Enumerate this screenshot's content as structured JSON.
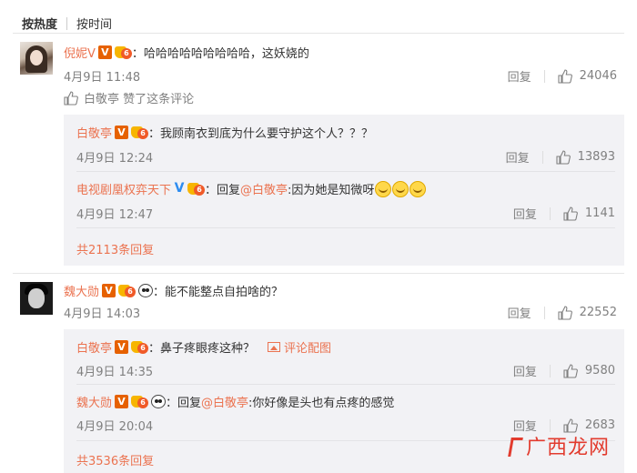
{
  "sort": {
    "hot": "按热度",
    "time": "按时间"
  },
  "labels": {
    "reply": "回复"
  },
  "comments": [
    {
      "user": "倪妮V",
      "text": "：哈哈哈哈哈哈哈哈哈，这妖娆的",
      "time": "4月9日 11:48",
      "likes": "24046",
      "liked_by": "白敬亭 赞了这条评论",
      "replies": [
        {
          "user": "白敬亭",
          "text": "：我顾南衣到底为什么要守护这个人？？？",
          "time": "4月9日 12:24",
          "likes": "13893"
        },
        {
          "user": "电视剧凰权弈天下",
          "reply_word": "：回复",
          "at": "@白敬亭",
          "text": ":因为她是知微呀",
          "time": "4月9日 12:47",
          "likes": "1141"
        }
      ],
      "more": "共2113条回复"
    },
    {
      "user": "魏大勋",
      "text": "：能不能整点自拍啥的？",
      "time": "4月9日 14:03",
      "likes": "22552",
      "replies": [
        {
          "user": "白敬亭",
          "text": "：鼻子疼眼疼这种？",
          "pic_label": "评论配图",
          "time": "4月9日 14:35",
          "likes": "9580"
        },
        {
          "user": "魏大勋",
          "reply_word": "：回复",
          "at": "@白敬亭",
          "text": ":你好像是头也有点疼的感觉",
          "time": "4月9日 20:04",
          "likes": "2683"
        }
      ],
      "more": "共3536条回复"
    }
  ],
  "watermark": "广西龙网",
  "colors": {
    "accent": "#eb7350",
    "muted": "#808080",
    "reply_bg": "#f2f2f5"
  }
}
